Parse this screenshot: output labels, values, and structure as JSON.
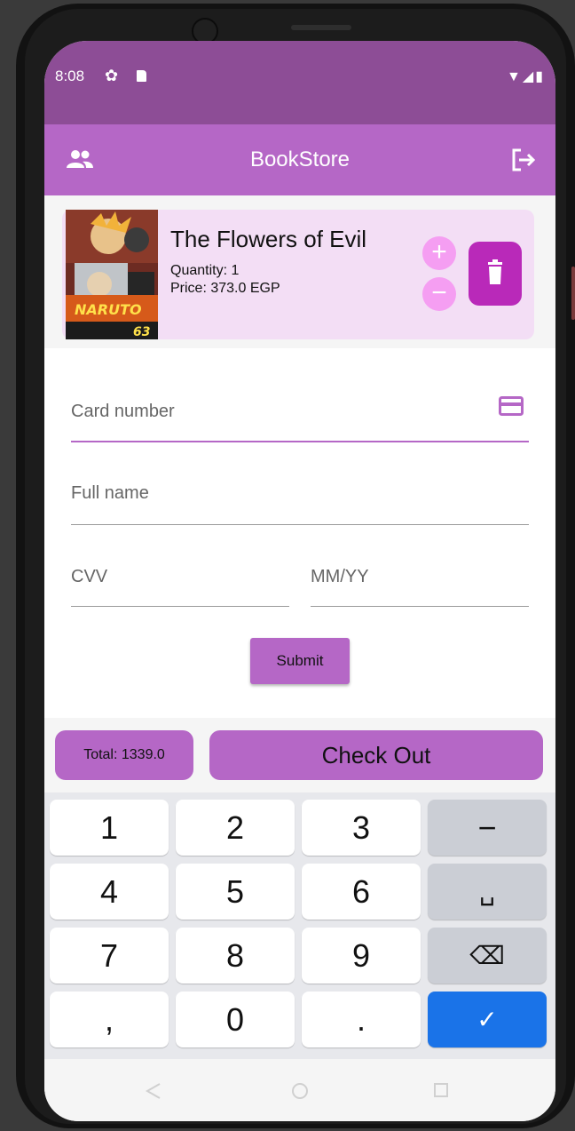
{
  "status_bar": {
    "time": "8:08",
    "icons": [
      "settings-icon",
      "sd-card-icon",
      "wifi-icon",
      "signal-icon",
      "battery-icon"
    ]
  },
  "app_bar": {
    "title": "BookStore",
    "left_icon": "people-icon",
    "right_icon": "logout-icon",
    "color": "#b567c6"
  },
  "cart_item": {
    "title": "The Flowers of Evil",
    "quantity": "Quantity: 1",
    "price": "Price: 373.0 EGP",
    "cover_text": "NARUTO",
    "cover_number": "63",
    "increase_label": "+",
    "decrease_label": "−",
    "delete_icon": "trash-icon"
  },
  "payment_form": {
    "card_number_placeholder": "Card number",
    "full_name_placeholder": "Full name",
    "cvv_placeholder": "CVV",
    "expiry_placeholder": "MM/YY",
    "submit_label": "Submit"
  },
  "footer": {
    "total": "Total: 1339.0",
    "checkout_label": "Check Out"
  },
  "keyboard": {
    "keys": [
      "1",
      "2",
      "3",
      "−",
      "4",
      "5",
      "6",
      "␣",
      "7",
      "8",
      "9",
      "⌫",
      ",",
      "0",
      ".",
      "✓"
    ]
  },
  "colors": {
    "accent": "#b567c6",
    "status_bar": "#8d4d96",
    "card_bg": "#f3def5",
    "delete": "#b929b9",
    "stepper": "#f59ef2",
    "done_key": "#1a73e8"
  }
}
